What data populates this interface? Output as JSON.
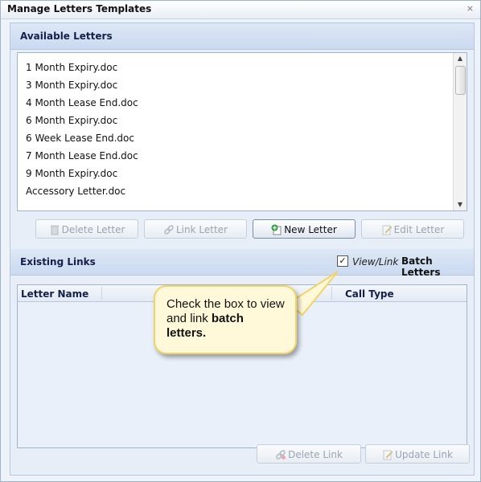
{
  "window": {
    "title": "Manage Letters Templates",
    "close_glyph": "⨯"
  },
  "available": {
    "header": "Available Letters",
    "items": [
      "1 Month Expiry.doc",
      "3 Month Expiry.doc",
      "4 Month Lease End.doc",
      "6 Month Expiry.doc",
      "6 Week Lease End.doc",
      "7 Month Lease End.doc",
      "9 Month Expiry.doc",
      "Accessory Letter.doc"
    ]
  },
  "buttons": {
    "delete_letter": "Delete Letter",
    "link_letter": "Link Letter",
    "new_letter": "New Letter",
    "edit_letter": "Edit Letter",
    "delete_link": "Delete Link",
    "update_link": "Update Link"
  },
  "links": {
    "header": "Existing Links",
    "view_link_label": "View/Link",
    "view_link_checked": true,
    "batch_label": "Batch Letters",
    "columns": {
      "letter_name": "Letter Name",
      "call_type": "Call Type"
    }
  },
  "callout": {
    "text_prefix": "Check the box to view and link ",
    "text_bold": "batch letters",
    "text_suffix": "."
  },
  "colors": {
    "accent": "#cbdaf0",
    "callout_bg": "#fff9d9",
    "callout_border": "#f1d36a",
    "new_letter_icon": "#2e9e3e"
  }
}
